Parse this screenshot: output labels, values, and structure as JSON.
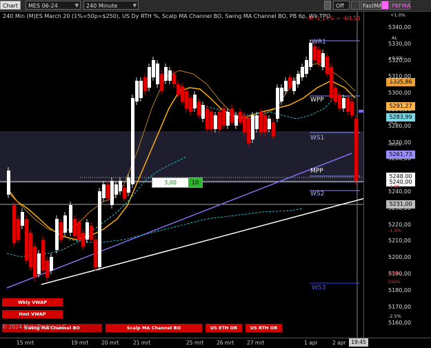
{
  "toolbar": {
    "chart_tab": "Chart",
    "instrument": "MES 06-24",
    "interval": "240 Minute",
    "off_label": "Off",
    "fastma_label": "FastMA",
    "pbfma_label": "PBFMA"
  },
  "title": "240 Min (M)ES March 20 (1%=50p=$250), US Dy RTH %, Scalp MA Channel BO, Swing MA Channel BO, PB 6p, Wk TPO",
  "change_text": "M -1,14% = -60,50",
  "price_labels": [
    "5340,00",
    "5330,00",
    "5320,00",
    "5310,00",
    "5300,00",
    "5290,00",
    "5280,00",
    "5270,00",
    "5260,00",
    "5250,00",
    "5240,00",
    "5230,00",
    "5220,00",
    "5210,00",
    "5200,00",
    "5190,00",
    "5180,00",
    "5170,00",
    "5160,00"
  ],
  "price_boxes": [
    {
      "text": "5305,86",
      "color": "#f0a030"
    },
    {
      "text": "5291,27",
      "color": "#ffb347"
    },
    {
      "text": "5283,99",
      "color": "#7ad7e6"
    },
    {
      "text": "5261,73",
      "color": "#9a8cff"
    },
    {
      "text": "5248,00",
      "color": "#ffffff"
    },
    {
      "text": "5240,00",
      "color": "#ffffff"
    },
    {
      "text": "5231,00",
      "color": "#bbbbbb"
    }
  ],
  "pct_labels": [
    {
      "text": "+1.0%",
      "red": false
    },
    {
      "text": "+0.5%",
      "red": false
    },
    {
      "text": "+0.2",
      "red": false
    },
    {
      "text": "-0.2",
      "red": false
    },
    {
      "text": "-0.5%",
      "red": false
    },
    {
      "text": "-1.0%",
      "red": true
    },
    {
      "text": "-1.5%",
      "red": true
    },
    {
      "text": "-2.0%",
      "red": true
    },
    {
      "text": "CLOS",
      "red": true
    },
    {
      "text": "-2.5%",
      "red": false
    },
    {
      "text": "AL",
      "red": false
    }
  ],
  "levels": {
    "wr1": "WR1",
    "wpp": "WPP",
    "ws1": "WS1",
    "mpp": "MPP",
    "ws2": "WS2",
    "ws3": "WS3"
  },
  "order": {
    "price": "3,00",
    "qty": "10"
  },
  "buttons": {
    "wkly_vwap": "Wkly VWAP",
    "hmt_vwap": "Hmt VWAP",
    "swing_ma": "Swing MA Channel BO",
    "scalp_ma": "Scalp MA Channel BO",
    "us_eth": "US ETH OR",
    "us_rth": "US RTH OR"
  },
  "copyright": "© 2024 NinjaTrader, LLC",
  "x_labels": [
    "15 mrt",
    "19 mrt",
    "20 mrt",
    "21 mrt",
    "25 mrt",
    "26 mrt",
    "27 mrt",
    "1 apr",
    "2 apr"
  ],
  "time_box": "19:45",
  "colors": {
    "bull": "#ffffff",
    "bear": "#e00000",
    "vwap": "#8080ff",
    "scalp": "#ffb000",
    "swing": "#f0a030",
    "channel": "#20c0d0"
  }
}
